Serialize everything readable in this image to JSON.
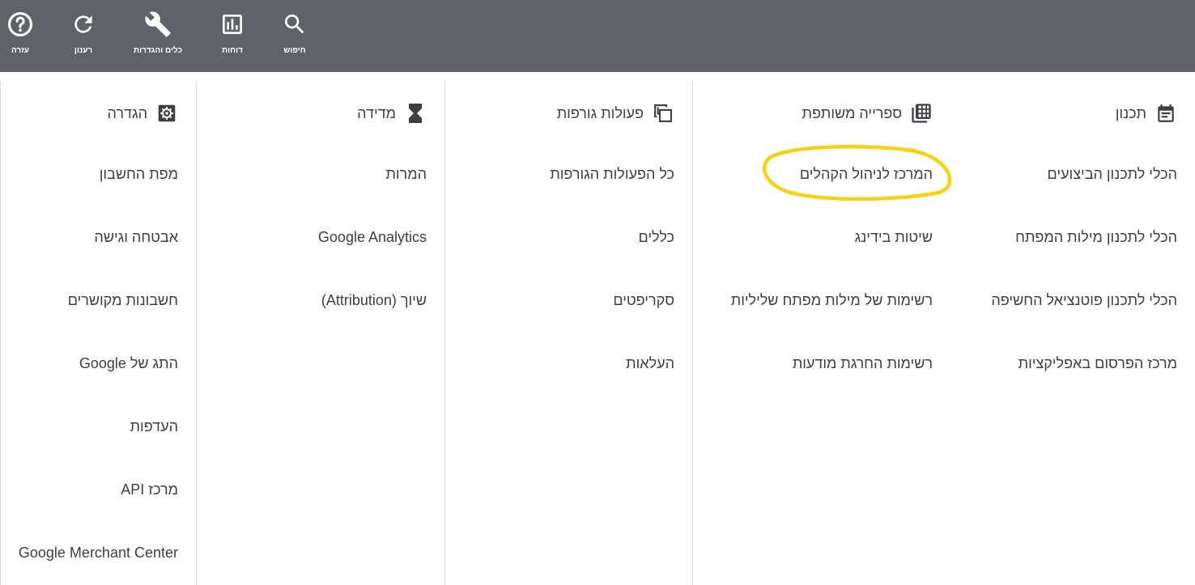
{
  "topbar": {
    "items": [
      {
        "label": "חיפוש",
        "icon": "search-icon"
      },
      {
        "label": "דוחות",
        "icon": "reports-icon"
      },
      {
        "label": "כלים והגדרות",
        "icon": "wrench-icon"
      },
      {
        "label": "רענון",
        "icon": "refresh-icon"
      },
      {
        "label": "עזרה",
        "icon": "help-icon"
      }
    ],
    "background": "#5f6368"
  },
  "columns": [
    {
      "title": "תכנון",
      "icon": "calendar-icon",
      "items": [
        "הכלי לתכנון הביצועים",
        "הכלי לתכנון מילות המפתח",
        "הכלי לתכנון פוטנציאל החשיפה",
        "מרכז הפרסום באפליקציות"
      ]
    },
    {
      "title": "ספרייה משותפת",
      "icon": "grid-icon",
      "items": [
        "המרכז לניהול הקהלים",
        "שיטות בידינג",
        "רשימות של מילות מפתח שליליות",
        "רשימות החרגת מודעות"
      ]
    },
    {
      "title": "פעולות גורפות",
      "icon": "copy-icon",
      "items": [
        "כל הפעולות הגורפות",
        "כללים",
        "סקריפטים",
        "העלאות"
      ]
    },
    {
      "title": "מדידה",
      "icon": "hourglass-icon",
      "items": [
        "המרות",
        "Google Analytics",
        "שיוך (Attribution)"
      ]
    },
    {
      "title": "הגדרה",
      "icon": "gear-icon",
      "items": [
        "מפת החשבון",
        "אבטחה וגישה",
        "חשבונות מקושרים",
        "התג של Google",
        "העדפות",
        "מרכז API",
        "Google Merchant Center"
      ]
    }
  ],
  "annotation": {
    "color": "#f5d213",
    "target": "המרכז לניהול הקהלים"
  }
}
